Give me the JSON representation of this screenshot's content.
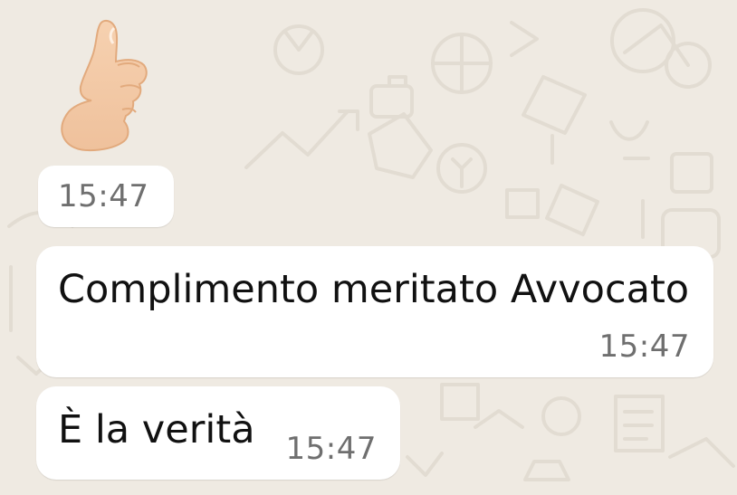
{
  "chat": {
    "messages": [
      {
        "type": "emoji",
        "emoji": "thumbs-up-icon",
        "time": "15:47"
      },
      {
        "type": "text",
        "text": "Complimento meritato Avvocato",
        "time": "15:47"
      },
      {
        "type": "text",
        "text": "È la verità",
        "time": "15:47"
      }
    ]
  },
  "colors": {
    "background": "#efeae2",
    "bubble": "#ffffff",
    "text": "#111111",
    "timestamp": "#6f6f6f"
  }
}
